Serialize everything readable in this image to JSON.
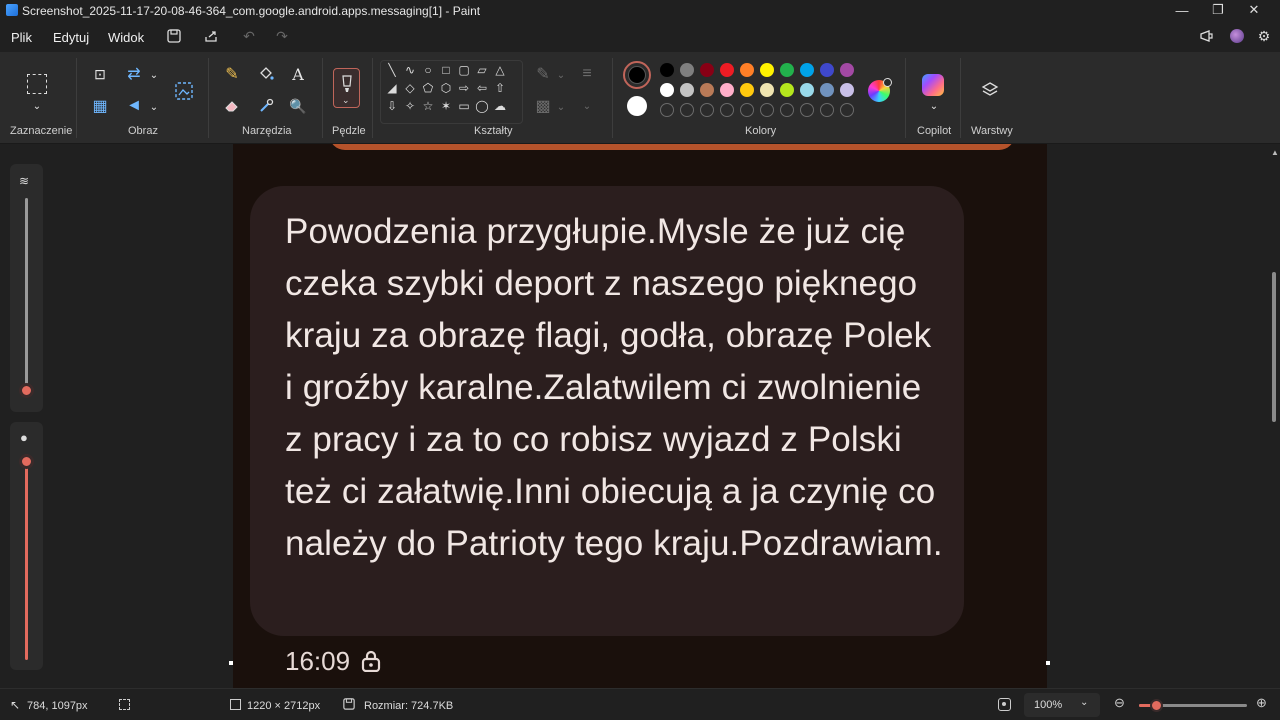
{
  "window": {
    "title": "Screenshot_2025-11-17-20-08-46-364_com.google.android.apps.messaging[1] - Paint"
  },
  "menu": {
    "file": "Plik",
    "edit": "Edytuj",
    "view": "Widok"
  },
  "ribbon": {
    "groups": {
      "selection": "Zaznaczenie",
      "image": "Obraz",
      "tools": "Narzędzia",
      "brushes": "Pędzle",
      "shapes": "Kształty",
      "colors": "Kolory",
      "copilot": "Copilot",
      "layers": "Warstwy"
    },
    "colors": {
      "primary": "#000000",
      "secondary": "#ffffff",
      "palette_row1": [
        "#000000",
        "#7f7f7f",
        "#880015",
        "#ed1c24",
        "#ff7f27",
        "#fff200",
        "#22b14c",
        "#00a2e8",
        "#3f48cc",
        "#a349a4"
      ],
      "palette_row2": [
        "#ffffff",
        "#c3c3c3",
        "#b97a57",
        "#ffaec9",
        "#ffc90e",
        "#efe4b0",
        "#b5e61d",
        "#99d9ea",
        "#7092be",
        "#c8bfe7"
      ]
    }
  },
  "canvas": {
    "message": "Powodzenia przygłupie.Mysle że już cię czeka szybki deport z naszego pięknego kraju za obrazę flagi, godła, obrazę Polek i groźby karalne.Zalatwilem ci zwolnienie z pracy i za to co robisz wyjazd z Polski też ci załatwię.Inni obiecują a ja czynię co należy do Patrioty tego kraju.Pozdrawiam.",
    "time": "16:09",
    "bubble_color": "#2b1e1e",
    "background_color": "#1a100c"
  },
  "status": {
    "cursor": "784, 1097px",
    "dimensions": "1220 × 2712px",
    "size": "Rozmiar: 724.7KB",
    "zoom": "100%"
  },
  "accent": "#e36b5e"
}
